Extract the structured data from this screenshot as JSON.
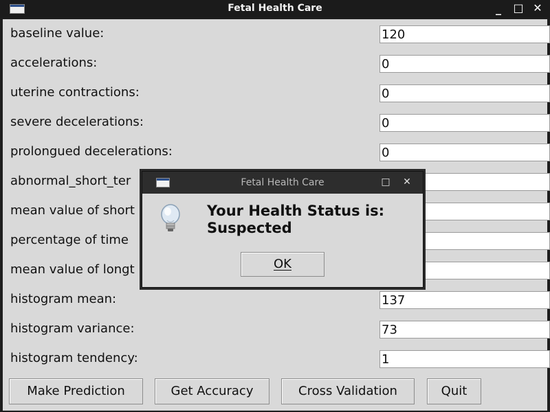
{
  "window": {
    "title": "Fetal Health Care"
  },
  "fields": [
    {
      "label": "baseline value:",
      "value": "120"
    },
    {
      "label": "accelerations:",
      "value": "0"
    },
    {
      "label": "uterine contractions:",
      "value": "0"
    },
    {
      "label": "severe decelerations:",
      "value": "0"
    },
    {
      "label": "prolongued decelerations:",
      "value": "0"
    },
    {
      "label": "abnormal_short_ter",
      "value": ""
    },
    {
      "label": "mean value of short",
      "value": ""
    },
    {
      "label": "percentage of time",
      "value": ""
    },
    {
      "label": "mean value of longt",
      "value": ""
    },
    {
      "label": "histogram mean:",
      "value": "137"
    },
    {
      "label": "histogram variance:",
      "value": "73"
    },
    {
      "label": "histogram tendency:",
      "value": "1"
    }
  ],
  "buttons": {
    "make_prediction": "Make Prediction",
    "get_accuracy": "Get Accuracy",
    "cross_validation": "Cross Validation",
    "quit": "Quit"
  },
  "dialog": {
    "title": "Fetal Health Care",
    "message_line1": "Your Health Status is:",
    "message_line2": "Suspected",
    "ok_label": "OK",
    "icon": "lightbulb-icon"
  }
}
